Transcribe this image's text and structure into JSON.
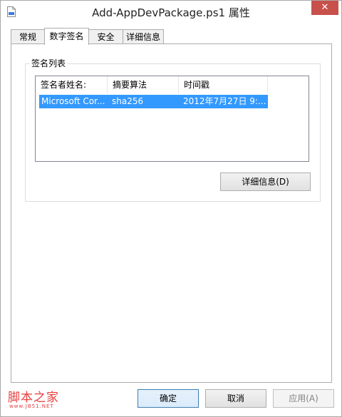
{
  "window": {
    "title": "Add-AppDevPackage.ps1 属性",
    "close_glyph": "✕"
  },
  "tabs": [
    {
      "label": "常规",
      "active": false
    },
    {
      "label": "数字签名",
      "active": true
    },
    {
      "label": "安全",
      "active": false
    },
    {
      "label": "详细信息",
      "active": false
    }
  ],
  "signature_group": {
    "legend": "签名列表",
    "columns": [
      "签名者姓名:",
      "摘要算法",
      "时间戳"
    ],
    "rows": [
      {
        "signer": "Microsoft Cor...",
        "digest": "sha256",
        "timestamp": "2012年7月27日 9:..."
      }
    ]
  },
  "details_button": {
    "label": "详细信息(D)"
  },
  "footer": {
    "ok_label": "确定",
    "cancel_label": "取消",
    "apply_label": "应用(A)"
  },
  "watermark": {
    "text": "脚本之家",
    "url": "www.JB51.NET"
  },
  "colors": {
    "selection": "#3399ff",
    "close_button": "#c7504b",
    "watermark": "#e83e3e"
  },
  "icons": {
    "title": "document-icon",
    "close": "close-icon"
  }
}
